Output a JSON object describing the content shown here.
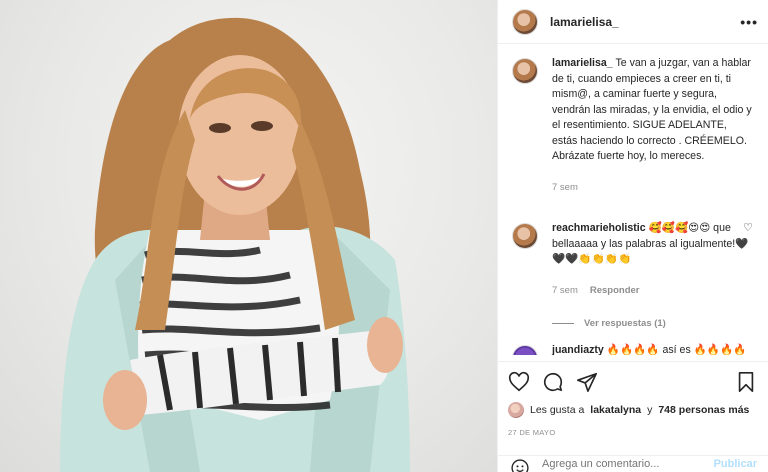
{
  "post": {
    "username": "lamarielisa_",
    "more_icon": "more-options-icon"
  },
  "caption": {
    "username": "lamarielisa_",
    "text": "Te van a juzgar, van a hablar de ti, cuando empieces a creer en ti, ti mism@, a caminar fuerte y segura, vendrán las miradas, y la envidia, el odio y el resentimiento. SIGUE ADELANTE, estás haciendo lo correcto . CRÉEMELO. Abrázate fuerte hoy, lo mereces.",
    "time": "7 sem"
  },
  "comments": [
    {
      "username": "reachmarieholistic",
      "text": "🥰🥰🥰😍😍 que bellaaaaa y las palabras al igualmente!🖤🖤🖤👏👏👏👏",
      "time": "7 sem",
      "reply_label": "Responder",
      "view_replies": "Ver respuestas (1)"
    },
    {
      "username": "juandiazty",
      "text": "🔥🔥🔥🔥 así es 🔥🔥🔥🔥"
    }
  ],
  "likes": {
    "prefix": "Les gusta a",
    "user": "lakatalyna",
    "suffix": "y",
    "others": "748 personas más"
  },
  "date": "27 DE MAYO",
  "add_comment": {
    "placeholder": "Agrega un comentario...",
    "publish": "Publicar"
  },
  "colors": {
    "border": "#efefef",
    "muted": "#8e8e8e",
    "publish": "#b2dffc",
    "jacket": "#c7e3dd"
  }
}
